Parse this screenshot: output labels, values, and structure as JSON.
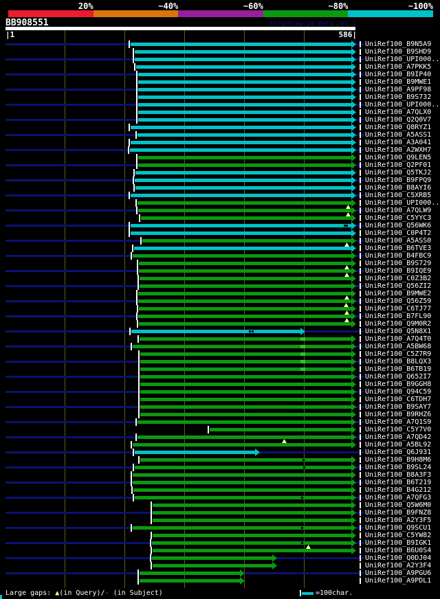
{
  "header": {
    "query_id": "BB908551",
    "credit": "AlignView.pm Beta rel.7",
    "scale_start": "|1",
    "scale_end": "586|"
  },
  "legend": {
    "gaps_prefix": "Large gaps: ",
    "gap_query_symbol": "▲",
    "gaps_mid": "(in Query)/",
    "gap_subject_symbol": "-",
    "gaps_suffix": " (in Subject)",
    "scale_sample_label": "=100char."
  },
  "colors": {
    "background": "#000000",
    "cyan_100": "#00c2c7",
    "green_80": "#0a9a0f",
    "purple_60": "#95209a",
    "orange_40": "#d9750a",
    "red_20": "#ec1b2d",
    "bright_segment": "#2cc42c",
    "row_baseline_navy": "#0a1270",
    "gridline_olive": "#5e5e20",
    "gap_marker_yellow": "#ffff9e",
    "text_white": "#ffffff",
    "credit_navy": "#12127e"
  },
  "chart_data": {
    "type": "bar",
    "subtype": "blast-alignment-overview",
    "query": {
      "id": "BB908551",
      "length": 586
    },
    "identity_key": [
      {
        "label": "20%",
        "color_ref": "red_20"
      },
      {
        "label": "~40%",
        "color_ref": "orange_40"
      },
      {
        "label": "~60%",
        "color_ref": "purple_60"
      },
      {
        "label": "~80%",
        "color_ref": "green_80"
      },
      {
        "label": "~100%",
        "color_ref": "cyan_100"
      }
    ],
    "grid_residues": [
      100,
      200,
      300,
      400,
      500
    ],
    "grid_interval_chars": 100,
    "marker_codes": {
      "gq": "large gap in query (yellow triangle)",
      "gs": "gap in subject (black dash)",
      "hb": "brighter segment"
    },
    "hits": [
      {
        "subject": "UniRef100_B9N5A9",
        "bucket": "c",
        "s": 190,
        "e": 517,
        "qs": 210,
        "qe": 586,
        "m": []
      },
      {
        "subject": "UniRef100_B9SHD9",
        "bucket": "c",
        "s": 196,
        "e": 517,
        "qs": 217,
        "qe": 586,
        "m": []
      },
      {
        "subject": "UniRef100_UPI000..",
        "bucket": "c",
        "s": 196,
        "e": 517,
        "qs": 217,
        "qe": 586,
        "m": []
      },
      {
        "subject": "UniRef100_A7PKK5",
        "bucket": "c",
        "s": 198,
        "e": 517,
        "qs": 219,
        "qe": 586,
        "m": []
      },
      {
        "subject": "UniRef100_B9IP40",
        "bucket": "c",
        "s": 201,
        "e": 517,
        "qs": 223,
        "qe": 586,
        "m": []
      },
      {
        "subject": "UniRef100_B9MWE1",
        "bucket": "c",
        "s": 201,
        "e": 517,
        "qs": 223,
        "qe": 586,
        "m": []
      },
      {
        "subject": "UniRef100_A9PF98",
        "bucket": "c",
        "s": 201,
        "e": 517,
        "qs": 223,
        "qe": 586,
        "m": []
      },
      {
        "subject": "UniRef100_B9S732",
        "bucket": "c",
        "s": 201,
        "e": 517,
        "qs": 223,
        "qe": 586,
        "m": []
      },
      {
        "subject": "UniRef100_UPI000..",
        "bucket": "c",
        "s": 201,
        "e": 517,
        "qs": 223,
        "qe": 586,
        "m": []
      },
      {
        "subject": "UniRef100_A7QLX0",
        "bucket": "c",
        "s": 201,
        "e": 517,
        "qs": 223,
        "qe": 586,
        "m": []
      },
      {
        "subject": "UniRef100_Q2Q0V7",
        "bucket": "c",
        "s": 201,
        "e": 517,
        "qs": 223,
        "qe": 586,
        "m": []
      },
      {
        "subject": "UniRef100_Q8RYZ1",
        "bucket": "c",
        "s": 190,
        "e": 517,
        "qs": 210,
        "qe": 586,
        "m": []
      },
      {
        "subject": "UniRef100_A5ASS1",
        "bucket": "c",
        "s": 200,
        "e": 517,
        "qs": 222,
        "qe": 586,
        "m": []
      },
      {
        "subject": "UniRef100_A3A041",
        "bucket": "c",
        "s": 190,
        "e": 517,
        "qs": 210,
        "qe": 586,
        "m": []
      },
      {
        "subject": "UniRef100_A2WXH7",
        "bucket": "c",
        "s": 189,
        "e": 517,
        "qs": 209,
        "qe": 586,
        "m": []
      },
      {
        "subject": "UniRef100_Q9LEN5",
        "bucket": "g",
        "s": 201,
        "e": 517,
        "qs": 223,
        "qe": 586,
        "m": []
      },
      {
        "subject": "UniRef100_Q2PF01",
        "bucket": "g",
        "s": 201,
        "e": 517,
        "qs": 223,
        "qe": 586,
        "m": []
      },
      {
        "subject": "UniRef100_Q5TKJ2",
        "bucket": "c",
        "s": 197,
        "e": 517,
        "qs": 218,
        "qe": 586,
        "m": []
      },
      {
        "subject": "UniRef100_B9FPQ9",
        "bucket": "c",
        "s": 196,
        "e": 517,
        "qs": 217,
        "qe": 586,
        "m": []
      },
      {
        "subject": "UniRef100_B8AYI6",
        "bucket": "c",
        "s": 197,
        "e": 517,
        "qs": 218,
        "qe": 586,
        "m": []
      },
      {
        "subject": "UniRef100_C5XRB5",
        "bucket": "c",
        "s": 190,
        "e": 517,
        "qs": 210,
        "qe": 586,
        "m": []
      },
      {
        "subject": "UniRef100_UPI000..",
        "bucket": "g",
        "s": 200,
        "e": 517,
        "qs": 222,
        "qe": 586,
        "m": []
      },
      {
        "subject": "UniRef100_A7QLW9",
        "bucket": "g",
        "s": 201,
        "e": 517,
        "qs": 223,
        "qe": 586,
        "m": [
          [
            "gq",
            506
          ]
        ]
      },
      {
        "subject": "UniRef100_C5YYC3",
        "bucket": "g",
        "s": 205,
        "e": 517,
        "qs": 227,
        "qe": 586,
        "m": [
          [
            "gq",
            506
          ]
        ]
      },
      {
        "subject": "UniRef100_Q56WK6",
        "bucket": "c",
        "s": 190,
        "e": 517,
        "qs": 210,
        "qe": 586,
        "m": [
          [
            "gs",
            500
          ],
          [
            "gs",
            503
          ]
        ]
      },
      {
        "subject": "UniRef100_C0P4T2",
        "bucket": "c",
        "s": 190,
        "e": 517,
        "qs": 210,
        "qe": 586,
        "m": []
      },
      {
        "subject": "UniRef100_A5ASS0",
        "bucket": "g",
        "s": 207,
        "e": 517,
        "qs": 230,
        "qe": 586,
        "m": []
      },
      {
        "subject": "UniRef100_B6TVE3",
        "bucket": "c",
        "s": 195,
        "e": 517,
        "qs": 216,
        "qe": 586,
        "m": [
          [
            "gq",
            504
          ]
        ]
      },
      {
        "subject": "UniRef100_B4FBC9",
        "bucket": "g",
        "s": 193,
        "e": 517,
        "qs": 214,
        "qe": 586,
        "m": []
      },
      {
        "subject": "UniRef100_B9S729",
        "bucket": "g",
        "s": 202,
        "e": 517,
        "qs": 224,
        "qe": 586,
        "m": []
      },
      {
        "subject": "UniRef100_B9IQE9",
        "bucket": "g",
        "s": 202,
        "e": 517,
        "qs": 224,
        "qe": 586,
        "m": [
          [
            "gq",
            504
          ]
        ]
      },
      {
        "subject": "UniRef100_C0Z3B2",
        "bucket": "g",
        "s": 203,
        "e": 517,
        "qs": 225,
        "qe": 586,
        "m": [
          [
            "gq",
            504
          ]
        ]
      },
      {
        "subject": "UniRef100_Q56ZI2",
        "bucket": "g",
        "s": 203,
        "e": 517,
        "qs": 225,
        "qe": 586,
        "m": []
      },
      {
        "subject": "UniRef100_B9MWE2",
        "bucket": "g",
        "s": 201,
        "e": 517,
        "qs": 223,
        "qe": 586,
        "m": []
      },
      {
        "subject": "UniRef100_Q56Z59",
        "bucket": "g",
        "s": 201,
        "e": 517,
        "qs": 223,
        "qe": 586,
        "m": [
          [
            "gq",
            504
          ]
        ]
      },
      {
        "subject": "UniRef100_C6TJ77",
        "bucket": "g",
        "s": 202,
        "e": 517,
        "qs": 224,
        "qe": 586,
        "m": [
          [
            "gq",
            503
          ]
        ]
      },
      {
        "subject": "UniRef100_B7FL90",
        "bucket": "g",
        "s": 201,
        "e": 517,
        "qs": 223,
        "qe": 586,
        "m": [
          [
            "gq",
            504
          ]
        ]
      },
      {
        "subject": "UniRef100_Q9M0R2",
        "bucket": "g",
        "s": 202,
        "e": 517,
        "qs": 224,
        "qe": 586,
        "m": [
          [
            "gq",
            504
          ]
        ]
      },
      {
        "subject": "UniRef100_Q5N8X1",
        "bucket": "c",
        "s": 191,
        "e": 443,
        "qs": 211,
        "qe": 501,
        "m": [
          [
            "gs",
            362
          ],
          [
            "gs",
            366
          ]
        ]
      },
      {
        "subject": "UniRef100_A7Q4T0",
        "bucket": "g",
        "s": 203,
        "e": 517,
        "qs": 225,
        "qe": 586,
        "m": [
          [
            "hb",
            440
          ]
        ]
      },
      {
        "subject": "UniRef100_A5BW68",
        "bucket": "g",
        "s": 193,
        "e": 517,
        "qs": 214,
        "qe": 586,
        "m": [
          [
            "hb",
            440
          ]
        ]
      },
      {
        "subject": "UniRef100_C5Z7R9",
        "bucket": "g",
        "s": 204,
        "e": 517,
        "qs": 226,
        "qe": 586,
        "m": [
          [
            "hb",
            440
          ]
        ]
      },
      {
        "subject": "UniRef100_B8LQX3",
        "bucket": "g",
        "s": 204,
        "e": 517,
        "qs": 226,
        "qe": 586,
        "m": [
          [
            "hb",
            440
          ]
        ]
      },
      {
        "subject": "UniRef100_B6TB19",
        "bucket": "g",
        "s": 204,
        "e": 517,
        "qs": 226,
        "qe": 586,
        "m": [
          [
            "hb",
            440
          ]
        ]
      },
      {
        "subject": "UniRef100_Q652I7",
        "bucket": "g",
        "s": 204,
        "e": 517,
        "qs": 226,
        "qe": 586,
        "m": []
      },
      {
        "subject": "UniRef100_B9GGH8",
        "bucket": "g",
        "s": 204,
        "e": 517,
        "qs": 226,
        "qe": 586,
        "m": []
      },
      {
        "subject": "UniRef100_Q94C59",
        "bucket": "g",
        "s": 204,
        "e": 517,
        "qs": 226,
        "qe": 586,
        "m": []
      },
      {
        "subject": "UniRef100_C6TDH7",
        "bucket": "g",
        "s": 204,
        "e": 517,
        "qs": 226,
        "qe": 586,
        "m": []
      },
      {
        "subject": "UniRef100_B9SAY7",
        "bucket": "g",
        "s": 204,
        "e": 517,
        "qs": 226,
        "qe": 586,
        "m": []
      },
      {
        "subject": "UniRef100_B9RHZ6",
        "bucket": "g",
        "s": 204,
        "e": 517,
        "qs": 226,
        "qe": 586,
        "m": []
      },
      {
        "subject": "UniRef100_A7Q1S9",
        "bucket": "g",
        "s": 200,
        "e": 517,
        "qs": 222,
        "qe": 586,
        "m": []
      },
      {
        "subject": "UniRef100_C5Y7V0",
        "bucket": "g",
        "s": 305,
        "e": 517,
        "qs": 342,
        "qe": 586,
        "m": []
      },
      {
        "subject": "UniRef100_A7QD42",
        "bucket": "g",
        "s": 200,
        "e": 517,
        "qs": 222,
        "qe": 586,
        "m": []
      },
      {
        "subject": "UniRef100_A5BL92",
        "bucket": "g",
        "s": 193,
        "e": 517,
        "qs": 214,
        "qe": 586,
        "m": [
          [
            "gq",
            413
          ]
        ]
      },
      {
        "subject": "UniRef100_Q6J931",
        "bucket": "c",
        "s": 196,
        "e": 377,
        "qs": 217,
        "qe": 425,
        "m": []
      },
      {
        "subject": "UniRef100_B9H8M6",
        "bucket": "g",
        "s": 204,
        "e": 517,
        "qs": 226,
        "qe": 586,
        "m": [
          [
            "gs",
            440
          ]
        ]
      },
      {
        "subject": "UniRef100_B9SL24",
        "bucket": "g",
        "s": 196,
        "e": 517,
        "qs": 217,
        "qe": 586,
        "m": [
          [
            "gs",
            441
          ]
        ]
      },
      {
        "subject": "UniRef100_B8A3F3",
        "bucket": "g",
        "s": 193,
        "e": 517,
        "qs": 214,
        "qe": 586,
        "m": []
      },
      {
        "subject": "UniRef100_B6T219",
        "bucket": "g",
        "s": 193,
        "e": 517,
        "qs": 214,
        "qe": 586,
        "m": []
      },
      {
        "subject": "UniRef100_B4G212",
        "bucket": "g",
        "s": 194,
        "e": 517,
        "qs": 215,
        "qe": 586,
        "m": []
      },
      {
        "subject": "UniRef100_A7QFG3",
        "bucket": "g",
        "s": 196,
        "e": 517,
        "qs": 217,
        "qe": 586,
        "m": [
          [
            "gs",
            438
          ]
        ]
      },
      {
        "subject": "UniRef100_Q5W6M0",
        "bucket": "g",
        "s": 222,
        "e": 517,
        "qs": 247,
        "qe": 586,
        "m": []
      },
      {
        "subject": "UniRef100_B9FNZ8",
        "bucket": "g",
        "s": 222,
        "e": 517,
        "qs": 247,
        "qe": 586,
        "m": []
      },
      {
        "subject": "UniRef100_A2Y3F5",
        "bucket": "g",
        "s": 222,
        "e": 517,
        "qs": 247,
        "qe": 586,
        "m": []
      },
      {
        "subject": "UniRef100_Q9SCU1",
        "bucket": "g",
        "s": 193,
        "e": 517,
        "qs": 214,
        "qe": 586,
        "m": [
          [
            "gs",
            438
          ]
        ]
      },
      {
        "subject": "UniRef100_C5YW82",
        "bucket": "g",
        "s": 222,
        "e": 517,
        "qs": 247,
        "qe": 586,
        "m": []
      },
      {
        "subject": "UniRef100_B9IGK1",
        "bucket": "g",
        "s": 221,
        "e": 517,
        "qs": 246,
        "qe": 586,
        "m": [
          [
            "gs",
            438
          ]
        ]
      },
      {
        "subject": "UniRef100_B6U0S4",
        "bucket": "g",
        "s": 222,
        "e": 517,
        "qs": 247,
        "qe": 586,
        "m": [
          [
            "gq",
            448
          ]
        ]
      },
      {
        "subject": "UniRef100_Q0DJ04",
        "bucket": "g",
        "s": 221,
        "e": 402,
        "qs": 246,
        "qe": 454,
        "m": []
      },
      {
        "subject": "UniRef100_A2Y3F4",
        "bucket": "g",
        "s": 222,
        "e": 402,
        "qs": 247,
        "qe": 454,
        "m": []
      },
      {
        "subject": "UniRef100_A9PGU6",
        "bucket": "g",
        "s": 203,
        "e": 355,
        "qs": 225,
        "qe": 400,
        "m": []
      },
      {
        "subject": "UniRef100_A9PDL1",
        "bucket": "g",
        "s": 203,
        "e": 355,
        "qs": 225,
        "qe": 400,
        "m": []
      }
    ]
  }
}
